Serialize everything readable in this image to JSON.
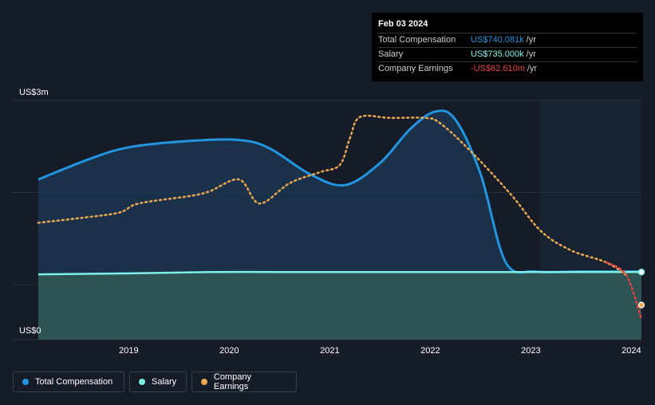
{
  "tooltip": {
    "date": "Feb 03 2024",
    "rows": [
      {
        "label": "Total Compensation",
        "value": "US$740.081k",
        "unit": "/yr"
      },
      {
        "label": "Salary",
        "value": "US$735.000k",
        "unit": "/yr"
      },
      {
        "label": "Company Earnings",
        "value": "-US$62.610m",
        "unit": "/yr"
      }
    ]
  },
  "legend": [
    {
      "label": "Total Compensation",
      "color": "#2394df"
    },
    {
      "label": "Salary",
      "color": "#7ff0e6"
    },
    {
      "label": "Company Earnings",
      "color": "#e9a851"
    }
  ],
  "colors": {
    "background": "#151b27",
    "total_compensation": "#2394df",
    "salary": "#7ff0e6",
    "company_earnings": "#e9a851",
    "company_earnings_negative": "#e64141"
  },
  "chart_data": {
    "type": "line",
    "y_axis": {
      "top_label": "US$3m",
      "bottom_label": "US$0",
      "ylim": [
        0,
        2.6
      ]
    },
    "x_ticks": [
      "2019",
      "2020",
      "2021",
      "2022",
      "2023",
      "2024"
    ],
    "xlim": [
      2018.1,
      2024.1
    ],
    "grid": true,
    "legend_placement": "bottom-left",
    "series": [
      {
        "name": "Total Compensation",
        "x": [
          2018.1,
          2018.6,
          2019.0,
          2019.6,
          2020.1,
          2020.4,
          2020.8,
          2021.15,
          2021.5,
          2021.8,
          2022.05,
          2022.25,
          2022.5,
          2022.75,
          2023.05,
          2023.5,
          2024.1
        ],
        "y": [
          1.74,
          1.96,
          2.09,
          2.16,
          2.17,
          2.08,
          1.8,
          1.68,
          1.92,
          2.29,
          2.48,
          2.39,
          1.8,
          0.84,
          0.74,
          0.74,
          0.74
        ]
      },
      {
        "name": "Salary",
        "x": [
          2018.1,
          2019.0,
          2019.8,
          2020.5,
          2021.0,
          2022.0,
          2023.0,
          2024.1
        ],
        "y": [
          0.71,
          0.72,
          0.735,
          0.735,
          0.735,
          0.735,
          0.735,
          0.735
        ]
      },
      {
        "name": "Company Earnings",
        "x": [
          2018.1,
          2018.5,
          2018.9,
          2019.1,
          2019.6,
          2019.8,
          2020.1,
          2020.3,
          2020.6,
          2020.9,
          2021.1,
          2021.2,
          2021.3,
          2021.6,
          2021.95,
          2022.1,
          2022.4,
          2022.8,
          2023.1,
          2023.4,
          2023.75,
          2023.95,
          2024.1
        ],
        "y": [
          1.27,
          1.32,
          1.38,
          1.48,
          1.56,
          1.61,
          1.74,
          1.48,
          1.7,
          1.82,
          1.9,
          2.19,
          2.42,
          2.41,
          2.41,
          2.35,
          2.05,
          1.58,
          1.18,
          0.97,
          0.84,
          0.7,
          0.22
        ]
      }
    ]
  }
}
